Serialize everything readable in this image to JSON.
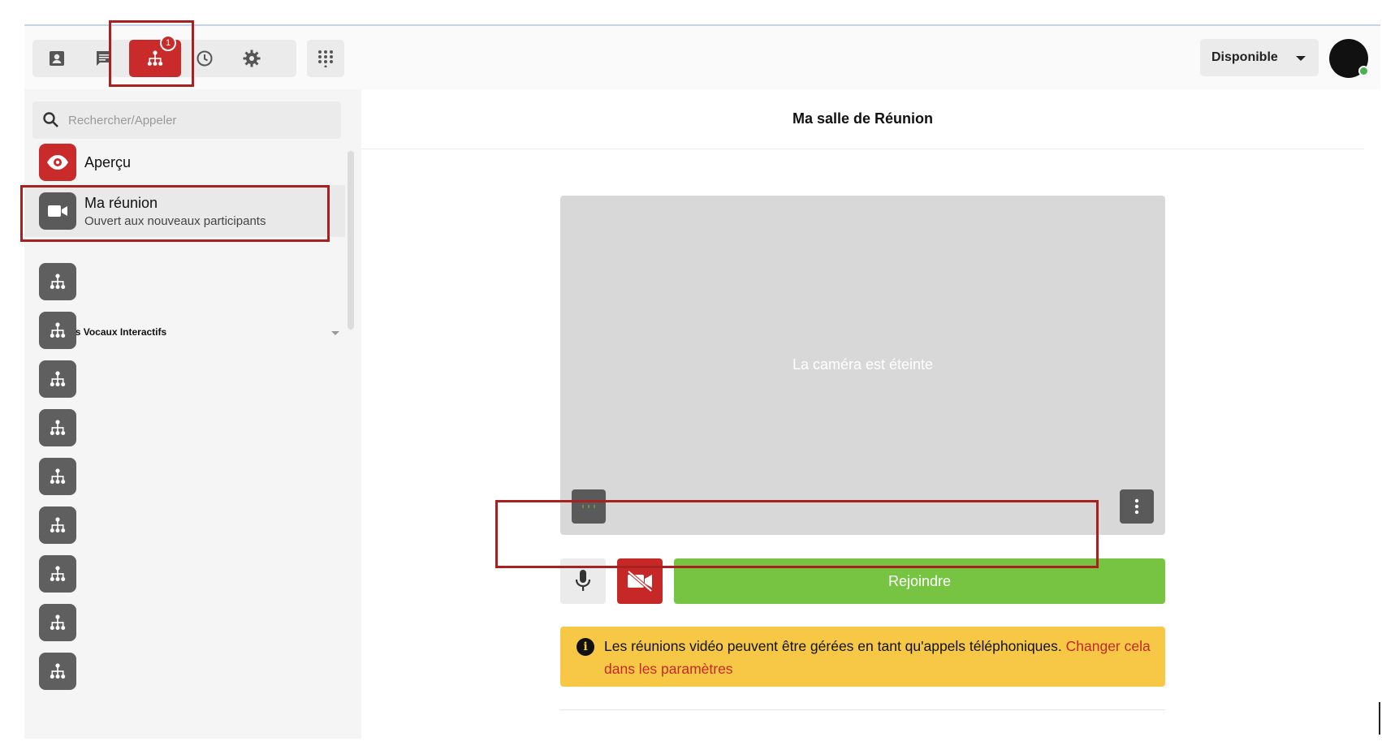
{
  "toolbar": {
    "tabs": [
      {
        "name": "contacts",
        "icon": "contact-card-icon"
      },
      {
        "name": "messages",
        "icon": "chat-icon"
      },
      {
        "name": "ivr",
        "icon": "org-chart-icon",
        "badge": "1",
        "active": true
      },
      {
        "name": "history",
        "icon": "history-icon"
      },
      {
        "name": "settings",
        "icon": "gear-icon"
      }
    ],
    "grid_icon": "grid-dots-icon",
    "status_label": "Disponible"
  },
  "sidebar": {
    "search_placeholder": "Rechercher/Appeler",
    "items": [
      {
        "title": "Aperçu",
        "subtitle": "",
        "icon": "eye-icon"
      },
      {
        "title": "Ma réunion",
        "subtitle": "Ouvert aux nouveaux participants",
        "icon": "video-camera-icon"
      }
    ],
    "section_title": "Serveurs Vocaux Interactifs",
    "ivr_icon": "org-chart-icon"
  },
  "main": {
    "title": "Ma salle de Réunion",
    "video_message": "La caméra est éteinte",
    "join_label": "Rejoindre",
    "notice_text": "Les réunions vidéo peuvent être gérées en tant qu'appels téléphoniques. ",
    "notice_link": "Changer cela dans les paramètres"
  },
  "colors": {
    "accent": "#c92b2b",
    "join": "#76c442",
    "notice": "#f6c846",
    "highlight": "#a8201f"
  }
}
